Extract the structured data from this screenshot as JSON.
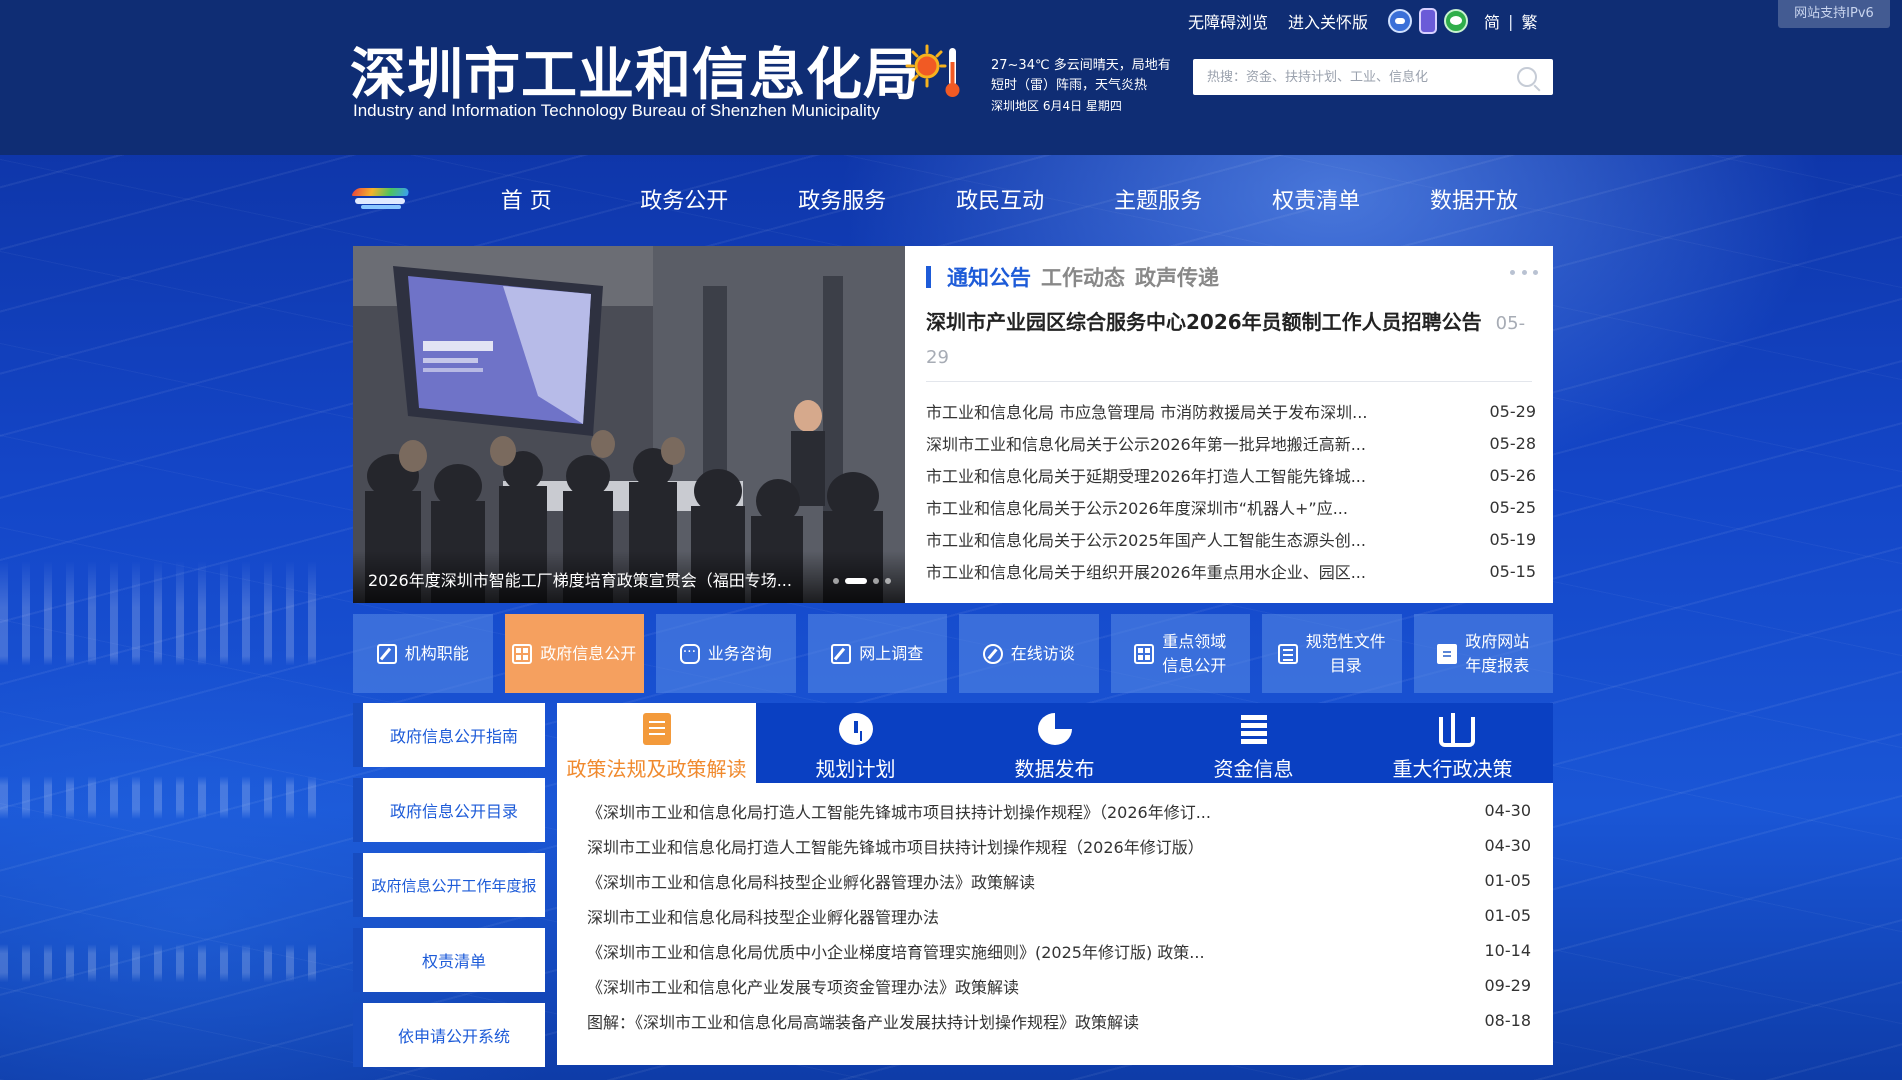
{
  "header": {
    "ipv6_badge": "网站支持IPv6",
    "accessibility": "无障碍浏览",
    "elderly_mode": "进入关怀版",
    "lang_simplified": "简",
    "lang_separator": "|",
    "lang_traditional": "繁",
    "title_cn": "深圳市工业和信息化局",
    "title_en": "Industry and Information Technology Bureau of Shenzhen Municipality",
    "weather_line1": "27~34℃  多云间晴天，局地有",
    "weather_line2": "短时（雷）阵雨，天气炎热",
    "weather_line3": "深圳地区 6月4日  星期四",
    "search_placeholder": "热搜：资金、扶持计划、工业、信息化",
    "icons": [
      "robot-icon",
      "phone-icon",
      "wechat-icon",
      "sun-thermometer-icon",
      "search-icon"
    ]
  },
  "nav": {
    "items": [
      "首 页",
      "政务公开",
      "政务服务",
      "政民互动",
      "主题服务",
      "权责清单",
      "数据开放"
    ]
  },
  "slider": {
    "caption": "2026年度深圳市智能工厂梯度培育政策宣贯会（福田专场...",
    "slide_count": 4,
    "active_index": 1
  },
  "news": {
    "tabs": [
      "通知公告",
      "工作动态",
      "政声传递"
    ],
    "active_tab": 0,
    "headline": "深圳市产业园区综合服务中心2026年员额制工作人员招聘公告",
    "headline_date": "05-29",
    "items": [
      {
        "title": "市工业和信息化局 市应急管理局 市消防救援局关于发布深圳...",
        "date": "05-29"
      },
      {
        "title": "深圳市工业和信息化局关于公示2026年第一批异地搬迁高新...",
        "date": "05-28"
      },
      {
        "title": "市工业和信息化局关于延期受理2026年打造人工智能先锋城...",
        "date": "05-26"
      },
      {
        "title": "市工业和信息化局关于公示2026年度深圳市“机器人+”应...",
        "date": "05-25"
      },
      {
        "title": "市工业和信息化局关于公示2025年国产人工智能生态源头创...",
        "date": "05-19"
      },
      {
        "title": "市工业和信息化局关于组织开展2026年重点用水企业、园区...",
        "date": "05-15"
      }
    ]
  },
  "quick": {
    "items": [
      {
        "label": "机构职能",
        "icon": "edit-icon"
      },
      {
        "label": "政府信息公开",
        "icon": "info-grid-icon"
      },
      {
        "label": "业务咨询",
        "icon": "chat-icon"
      },
      {
        "label": "网上调查",
        "icon": "survey-icon"
      },
      {
        "label": "在线访谈",
        "icon": "compass-icon"
      },
      {
        "label": "重点领域\n信息公开",
        "icon": "grid-icon"
      },
      {
        "label": "规范性文件\n目录",
        "icon": "list-icon"
      },
      {
        "label": "政府网站\n年度报表",
        "icon": "clipboard-icon"
      }
    ],
    "active_index": 1
  },
  "side": {
    "items": [
      "政府信息公开指南",
      "政府信息公开目录",
      "政府信息公开工作年度报",
      "权责清单",
      "依申请公开系统"
    ]
  },
  "policy_tabs": {
    "items": [
      {
        "label": "政策法规及政策解读",
        "icon": "book-icon"
      },
      {
        "label": "规划计划",
        "icon": "clock-icon"
      },
      {
        "label": "数据发布",
        "icon": "pie-chart-icon"
      },
      {
        "label": "资金信息",
        "icon": "stacked-bars-icon"
      },
      {
        "label": "重大行政决策",
        "icon": "scale-icon"
      }
    ],
    "active_index": 0
  },
  "policy": {
    "items": [
      {
        "title": "《深圳市工业和信息化局打造人工智能先锋城市项目扶持计划操作规程》（2026年修订...",
        "date": "04-30"
      },
      {
        "title": "深圳市工业和信息化局打造人工智能先锋城市项目扶持计划操作规程（2026年修订版）",
        "date": "04-30"
      },
      {
        "title": "《深圳市工业和信息化局科技型企业孵化器管理办法》政策解读",
        "date": "01-05"
      },
      {
        "title": "深圳市工业和信息化局科技型企业孵化器管理办法",
        "date": "01-05"
      },
      {
        "title": "《深圳市工业和信息化局优质中小企业梯度培育管理实施细则》(2025年修订版) 政策...",
        "date": "10-14"
      },
      {
        "title": "《深圳市工业和信息化产业发展专项资金管理办法》政策解读",
        "date": "09-29"
      },
      {
        "title": "图解：《深圳市工业和信息化局高端装备产业发展扶持计划操作规程》政策解读",
        "date": "08-18"
      }
    ]
  }
}
